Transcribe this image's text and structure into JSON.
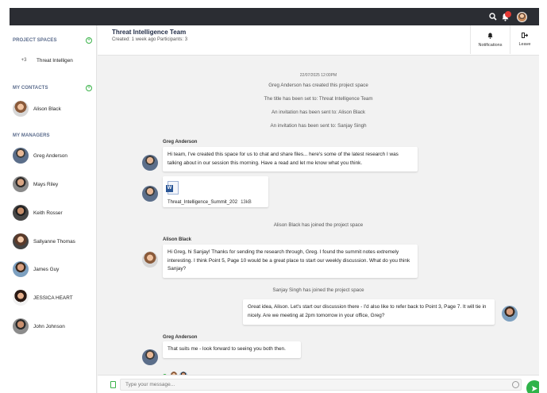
{
  "sidebar": {
    "project_spaces_label": "PROJECT SPACES",
    "project_items": [
      {
        "count": "+3",
        "label": "Threat Intelligen"
      }
    ],
    "contacts_label": "MY CONTACTS",
    "contacts": [
      {
        "name": "Alison Black"
      }
    ],
    "managers_label": "MY MANAGERS",
    "managers": [
      {
        "name": "Greg Anderson"
      },
      {
        "name": "Mays Riley"
      },
      {
        "name": "Keith Rosser"
      },
      {
        "name": "Sallyanne Thomas"
      },
      {
        "name": "James Guy"
      },
      {
        "name": "JESSICA HEART"
      },
      {
        "name": "John Johnson"
      }
    ]
  },
  "header": {
    "title": "Threat Intelligence Team",
    "meta": "Created: 1 week ago   Participants: 3",
    "notifications_label": "Notifications",
    "leave_label": "Leave"
  },
  "chat": {
    "timestamp": "22/07/2025 12:00PM",
    "system_messages": [
      "Greg Anderson has created this project space",
      "The title has been set to: Threat Intelligence Team",
      "An invitation has been sent to: Alison Black",
      "An invitation has been sent to: Sanjay Singh"
    ],
    "msg1_sender": "Greg Anderson",
    "msg1_text": "Hi team, I've created this space for us to chat and share files... here's some of the latest research I was talking about in our session this morning. Have a read and let me know what you think.",
    "file_name": "Threat_Intelligence_Summit_202",
    "file_size": "13kB",
    "join1": "Alison Black has joined the project space",
    "msg2_sender": "Alison Black",
    "msg2_text": "Hi Greg, hi Sanjay! Thanks for sending the research through, Greg. I found the summit notes extremely interesting. I think Point 5, Page 10 would be a great place to start our weekly discussion. What do you think Sanjay?",
    "join2": "Sanjay Singh has joined the project space",
    "msg3_text": "Great idea, Alison. Let's start our discussion there - I'd also like to refer back to Point 3, Page 7. It will tie in nicely. Are we meeting at 2pm tomorrow in your office, Greg?",
    "msg4_sender": "Greg Anderson",
    "msg4_text": "That suits me - look forward to seeing you both then."
  },
  "composer": {
    "placeholder": "Type your message..."
  },
  "icons": {
    "search": "search-icon",
    "alert": "bell-alert-icon",
    "notifications": "bell-icon",
    "leave": "exit-icon",
    "send": "send-icon"
  }
}
